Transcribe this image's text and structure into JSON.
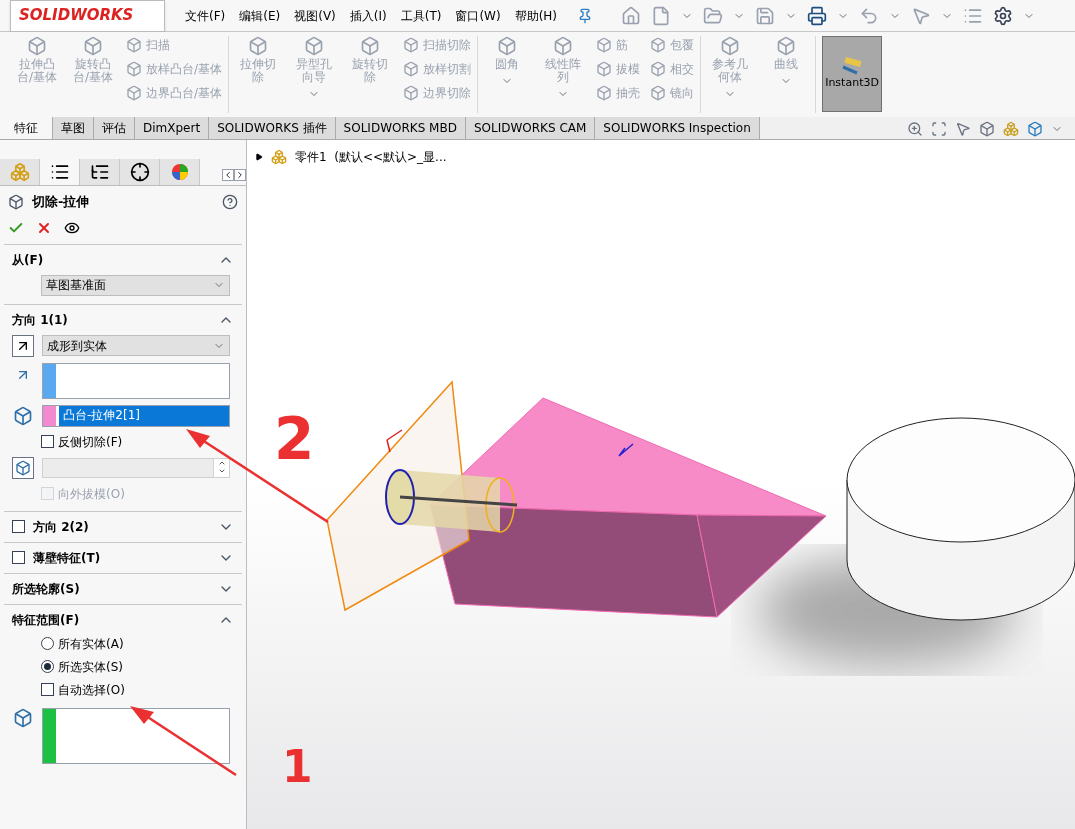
{
  "menu": {
    "logo": "SOLIDWORKS",
    "items": [
      "文件(F)",
      "编辑(E)",
      "视图(V)",
      "插入(I)",
      "工具(T)",
      "窗口(W)",
      "帮助(H)"
    ]
  },
  "ribbon": {
    "groups": [
      {
        "items": [
          {
            "kind": "big",
            "label": "拉伸凸台/基体",
            "disabled": true
          },
          {
            "kind": "big",
            "label": "旋转凸台/基体",
            "disabled": true
          },
          {
            "kind": "column",
            "entries": [
              {
                "label": "扫描",
                "disabled": true
              },
              {
                "label": "放样凸台/基体",
                "disabled": true
              },
              {
                "label": "边界凸台/基体",
                "disabled": true
              }
            ]
          }
        ]
      },
      {
        "items": [
          {
            "kind": "big",
            "label": "拉伸切除",
            "disabled": true
          },
          {
            "kind": "bigcaret",
            "label": "异型孔向导",
            "disabled": true
          },
          {
            "kind": "big",
            "label": "旋转切除",
            "disabled": true
          },
          {
            "kind": "column",
            "entries": [
              {
                "label": "扫描切除",
                "disabled": true
              },
              {
                "label": "放样切割",
                "disabled": true
              },
              {
                "label": "边界切除",
                "disabled": true
              }
            ]
          }
        ]
      },
      {
        "items": [
          {
            "kind": "bigcaret",
            "label": "圆角",
            "disabled": true
          },
          {
            "kind": "bigcaret",
            "label": "线性阵列",
            "disabled": true
          },
          {
            "kind": "column",
            "entries": [
              {
                "label": "筋",
                "disabled": true
              },
              {
                "label": "拔模",
                "disabled": true
              },
              {
                "label": "抽壳",
                "disabled": true
              }
            ]
          },
          {
            "kind": "column",
            "entries": [
              {
                "label": "包覆",
                "disabled": true
              },
              {
                "label": "相交",
                "disabled": true
              },
              {
                "label": "镜向",
                "disabled": true
              }
            ]
          }
        ]
      },
      {
        "items": [
          {
            "kind": "bigcaret",
            "label": "参考几何体",
            "disabled": true
          },
          {
            "kind": "bigcaret",
            "label": "曲线",
            "disabled": true
          }
        ]
      },
      {
        "items": [
          {
            "kind": "toggle",
            "label": "Instant3D",
            "on": true
          }
        ]
      }
    ]
  },
  "command_tabs": [
    {
      "label": "特征",
      "selected": true
    },
    {
      "label": "草图",
      "selected": false
    },
    {
      "label": "评估",
      "selected": false
    },
    {
      "label": "DimXpert",
      "selected": false
    },
    {
      "label": "SOLIDWORKS 插件",
      "selected": false
    },
    {
      "label": "SOLIDWORKS MBD",
      "selected": false
    },
    {
      "label": "SOLIDWORKS CAM",
      "selected": false
    },
    {
      "label": "SOLIDWORKS Inspection",
      "selected": false
    }
  ],
  "panel": {
    "tabs": [
      {
        "selected": false
      },
      {
        "selected": true
      },
      {
        "selected": false
      },
      {
        "selected": false
      },
      {
        "selected": false
      }
    ],
    "title": "切除-拉伸",
    "sections": [
      {
        "kind": "from",
        "title": "从(F)",
        "expanded": true,
        "select": "草图基准面"
      },
      {
        "kind": "direction",
        "title": "方向 1(1)",
        "expanded": true,
        "select": "成形到实体",
        "selection": "凸台-拉伸2[1]",
        "reverse": {
          "label": "反侧切除(F)",
          "checked": false
        },
        "draft": {
          "label": "向外拔模(O)",
          "checked": false,
          "disabled": true
        }
      },
      {
        "kind": "check",
        "title": "方向 2(2)",
        "checked": false,
        "expanded": false
      },
      {
        "kind": "check",
        "title": "薄壁特征(T)",
        "checked": false,
        "expanded": false
      },
      {
        "kind": "plain",
        "title": "所选轮廓(S)",
        "expanded": false
      },
      {
        "kind": "scope",
        "title": "特征范围(F)",
        "expanded": true,
        "radios": [
          {
            "label": "所有实体(A)",
            "selected": false
          },
          {
            "label": "所选实体(S)",
            "selected": true
          }
        ],
        "auto": {
          "label": "自动选择(O)",
          "checked": false
        }
      }
    ]
  },
  "viewport": {
    "tree": "零件1  (默认<<默认>_显..."
  },
  "annotations": [
    "2",
    "1"
  ]
}
